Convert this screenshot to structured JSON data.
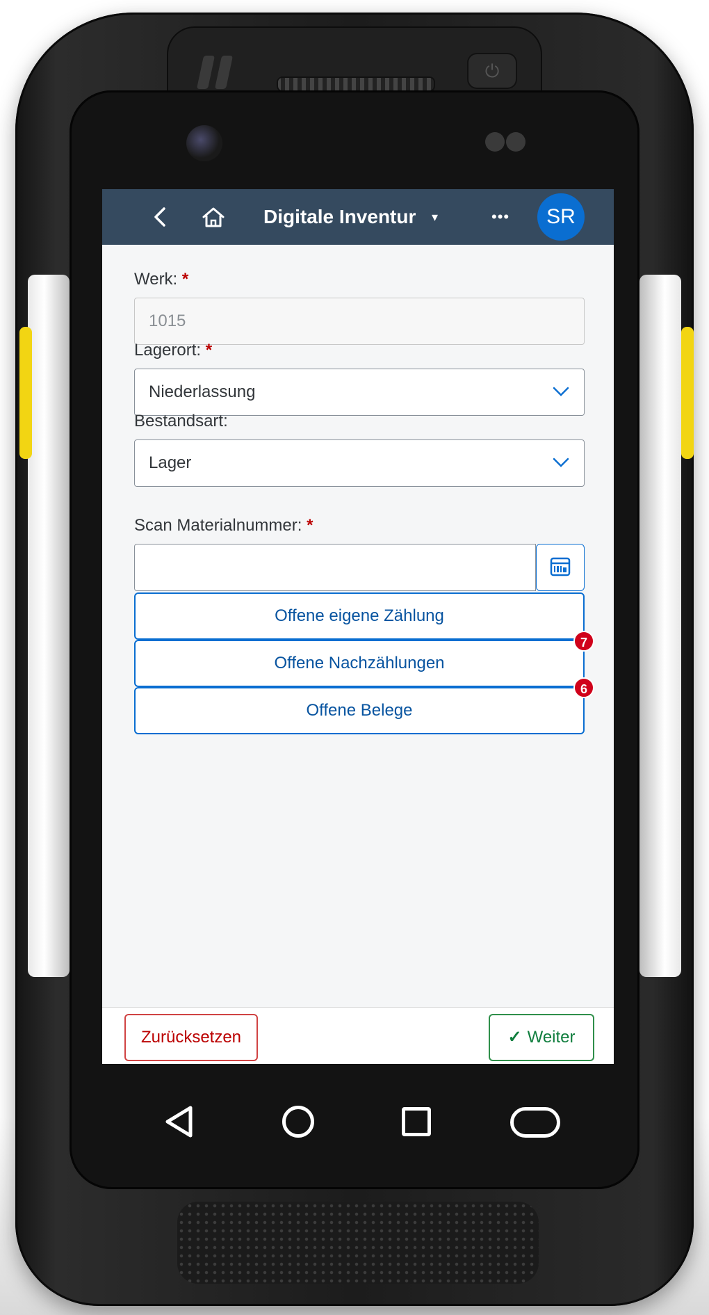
{
  "shellbar": {
    "title": "Digitale Inventur",
    "caret": "▾",
    "more": "•••",
    "avatar": "SR"
  },
  "form": {
    "werk_label": "Werk:",
    "werk_value": "1015",
    "lagerort_label": "Lagerort:",
    "lagerort_value": "Niederlassung",
    "bestandsart_label": "Bestandsart:",
    "bestandsart_value": "Lager",
    "scan_label": "Scan Materialnummer:",
    "scan_value": "",
    "required_mark": "*"
  },
  "actions": {
    "own_count_label": "Offene eigene Zählung",
    "recount_label": "Offene Nachzählungen",
    "recount_badge": "7",
    "documents_label": "Offene Belege",
    "documents_badge": "6"
  },
  "footer": {
    "reset_label": "Zurücksetzen",
    "next_label": "Weiter",
    "next_check": "✓"
  },
  "icons": {
    "back": "chevron-left-icon",
    "home": "home-icon",
    "scan": "barcode-scan-icon",
    "dropdown": "chevron-down-icon"
  },
  "colors": {
    "shellbar": "#354a5f",
    "avatar": "#0a6ed1",
    "required": "#bb0000",
    "badge": "#d0021b",
    "reset": "#bb0000",
    "next": "#107e3e"
  }
}
